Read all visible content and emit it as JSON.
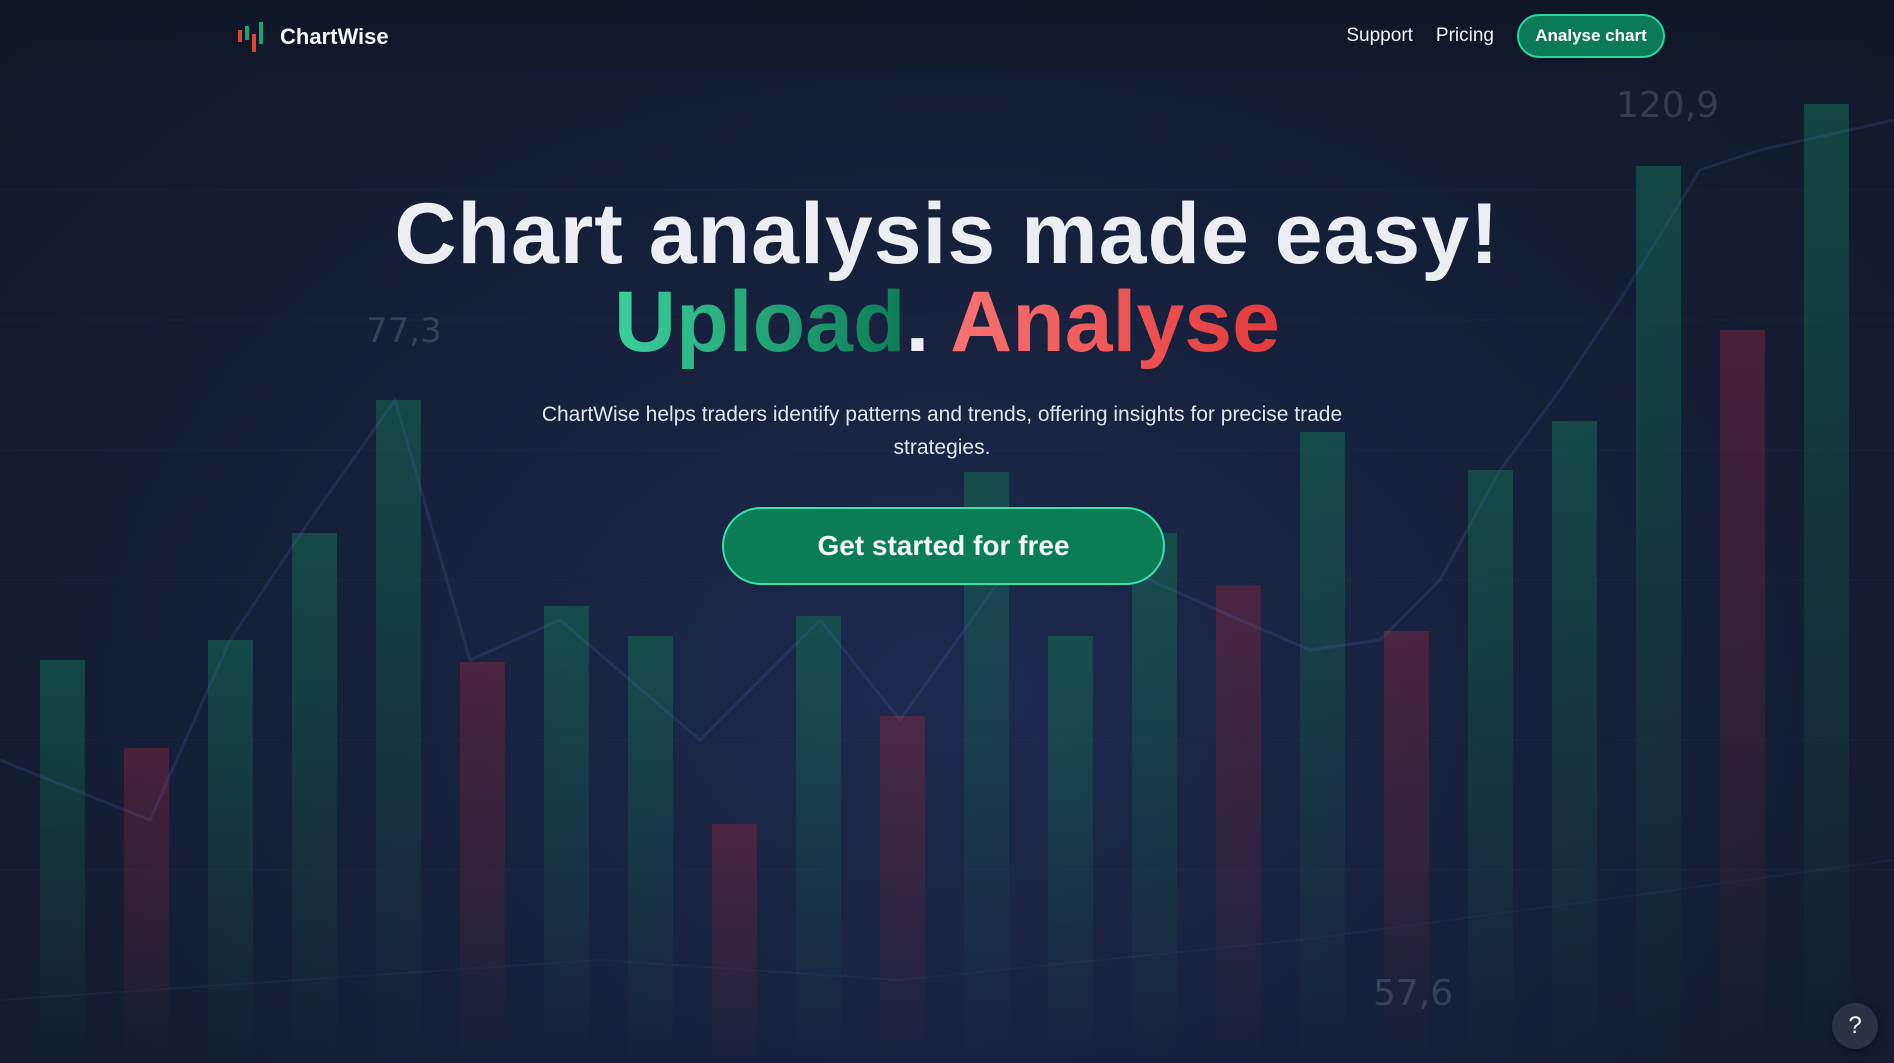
{
  "brand": {
    "name": "ChartWise",
    "logo_icon": "candlestick-logo-icon"
  },
  "nav": {
    "links": [
      "Support",
      "Pricing"
    ],
    "cta_label": "Analyse chart"
  },
  "hero": {
    "headline": "Chart analysis made easy!",
    "word_upload": "Upload",
    "separator": ".",
    "word_analyse": "Analyse",
    "subtitle": "ChartWise helps traders identify patterns and trends, offering insights for precise trade strategies.",
    "cta_label": "Get started for free"
  },
  "background_labels": [
    "120,9",
    "77,3",
    "57,6"
  ],
  "help": {
    "label": "?"
  },
  "colors": {
    "accent_green": "#0a7d57",
    "accent_red": "#e43a3a",
    "background": "#16203b"
  }
}
